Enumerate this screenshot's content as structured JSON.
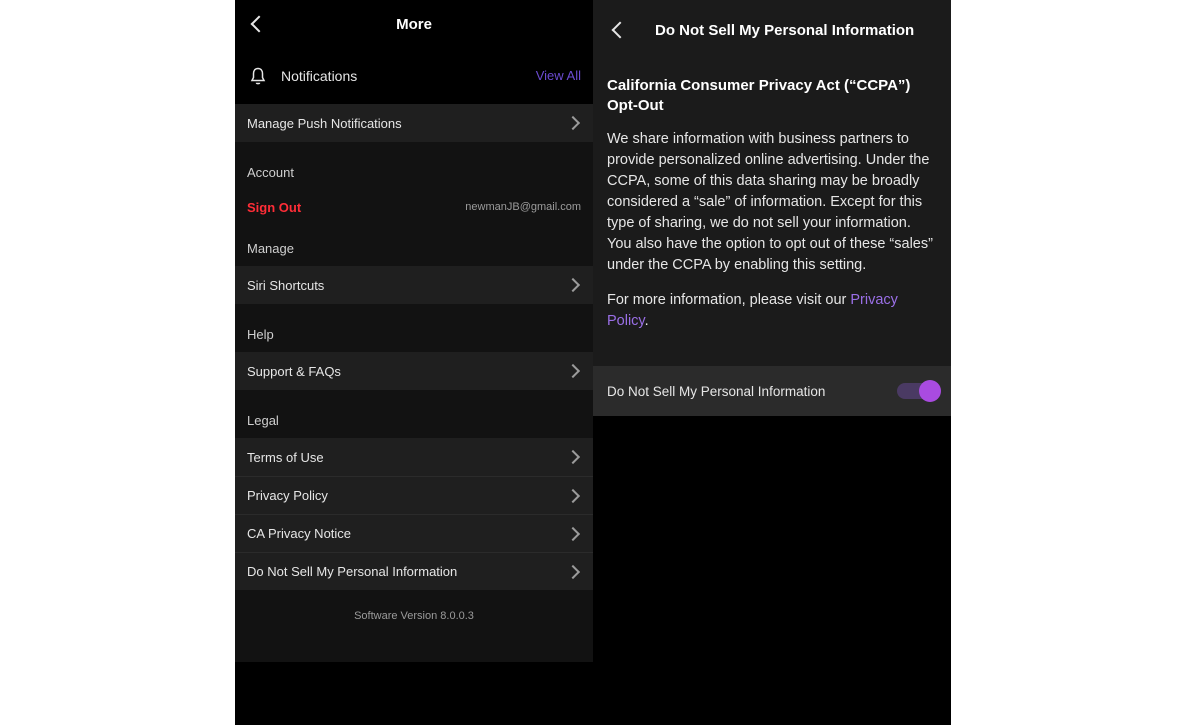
{
  "left": {
    "title": "More",
    "notifications": {
      "label": "Notifications",
      "viewAll": "View All"
    },
    "rows": {
      "managePush": "Manage Push Notifications",
      "siri": "Siri Shortcuts",
      "support": "Support & FAQs",
      "terms": "Terms of Use",
      "privacy": "Privacy Policy",
      "caPrivacy": "CA Privacy Notice",
      "dnsmpi": "Do Not Sell My Personal Information"
    },
    "sections": {
      "account": "Account",
      "manage": "Manage",
      "help": "Help",
      "legal": "Legal"
    },
    "signOut": {
      "label": "Sign Out",
      "email": "newmanJB@gmail.com"
    },
    "version": "Software Version 8.0.0.3"
  },
  "right": {
    "title": "Do Not Sell My Personal Information",
    "heading": "California Consumer Privacy Act (“CCPA”) Opt-Out",
    "body": "We share information with business partners to provide personalized online advertising. Under the CCPA, some of this data sharing may be broadly considered a “sale” of information. Except for this type of sharing, we do not sell your information. You also have the option to opt out of these “sales” under the CCPA by enabling this setting.",
    "moreInfoPrefix": "For more information, please visit our ",
    "privacyLink": "Privacy Policy",
    "period": ".",
    "toggleLabel": "Do Not Sell My Personal Information"
  }
}
